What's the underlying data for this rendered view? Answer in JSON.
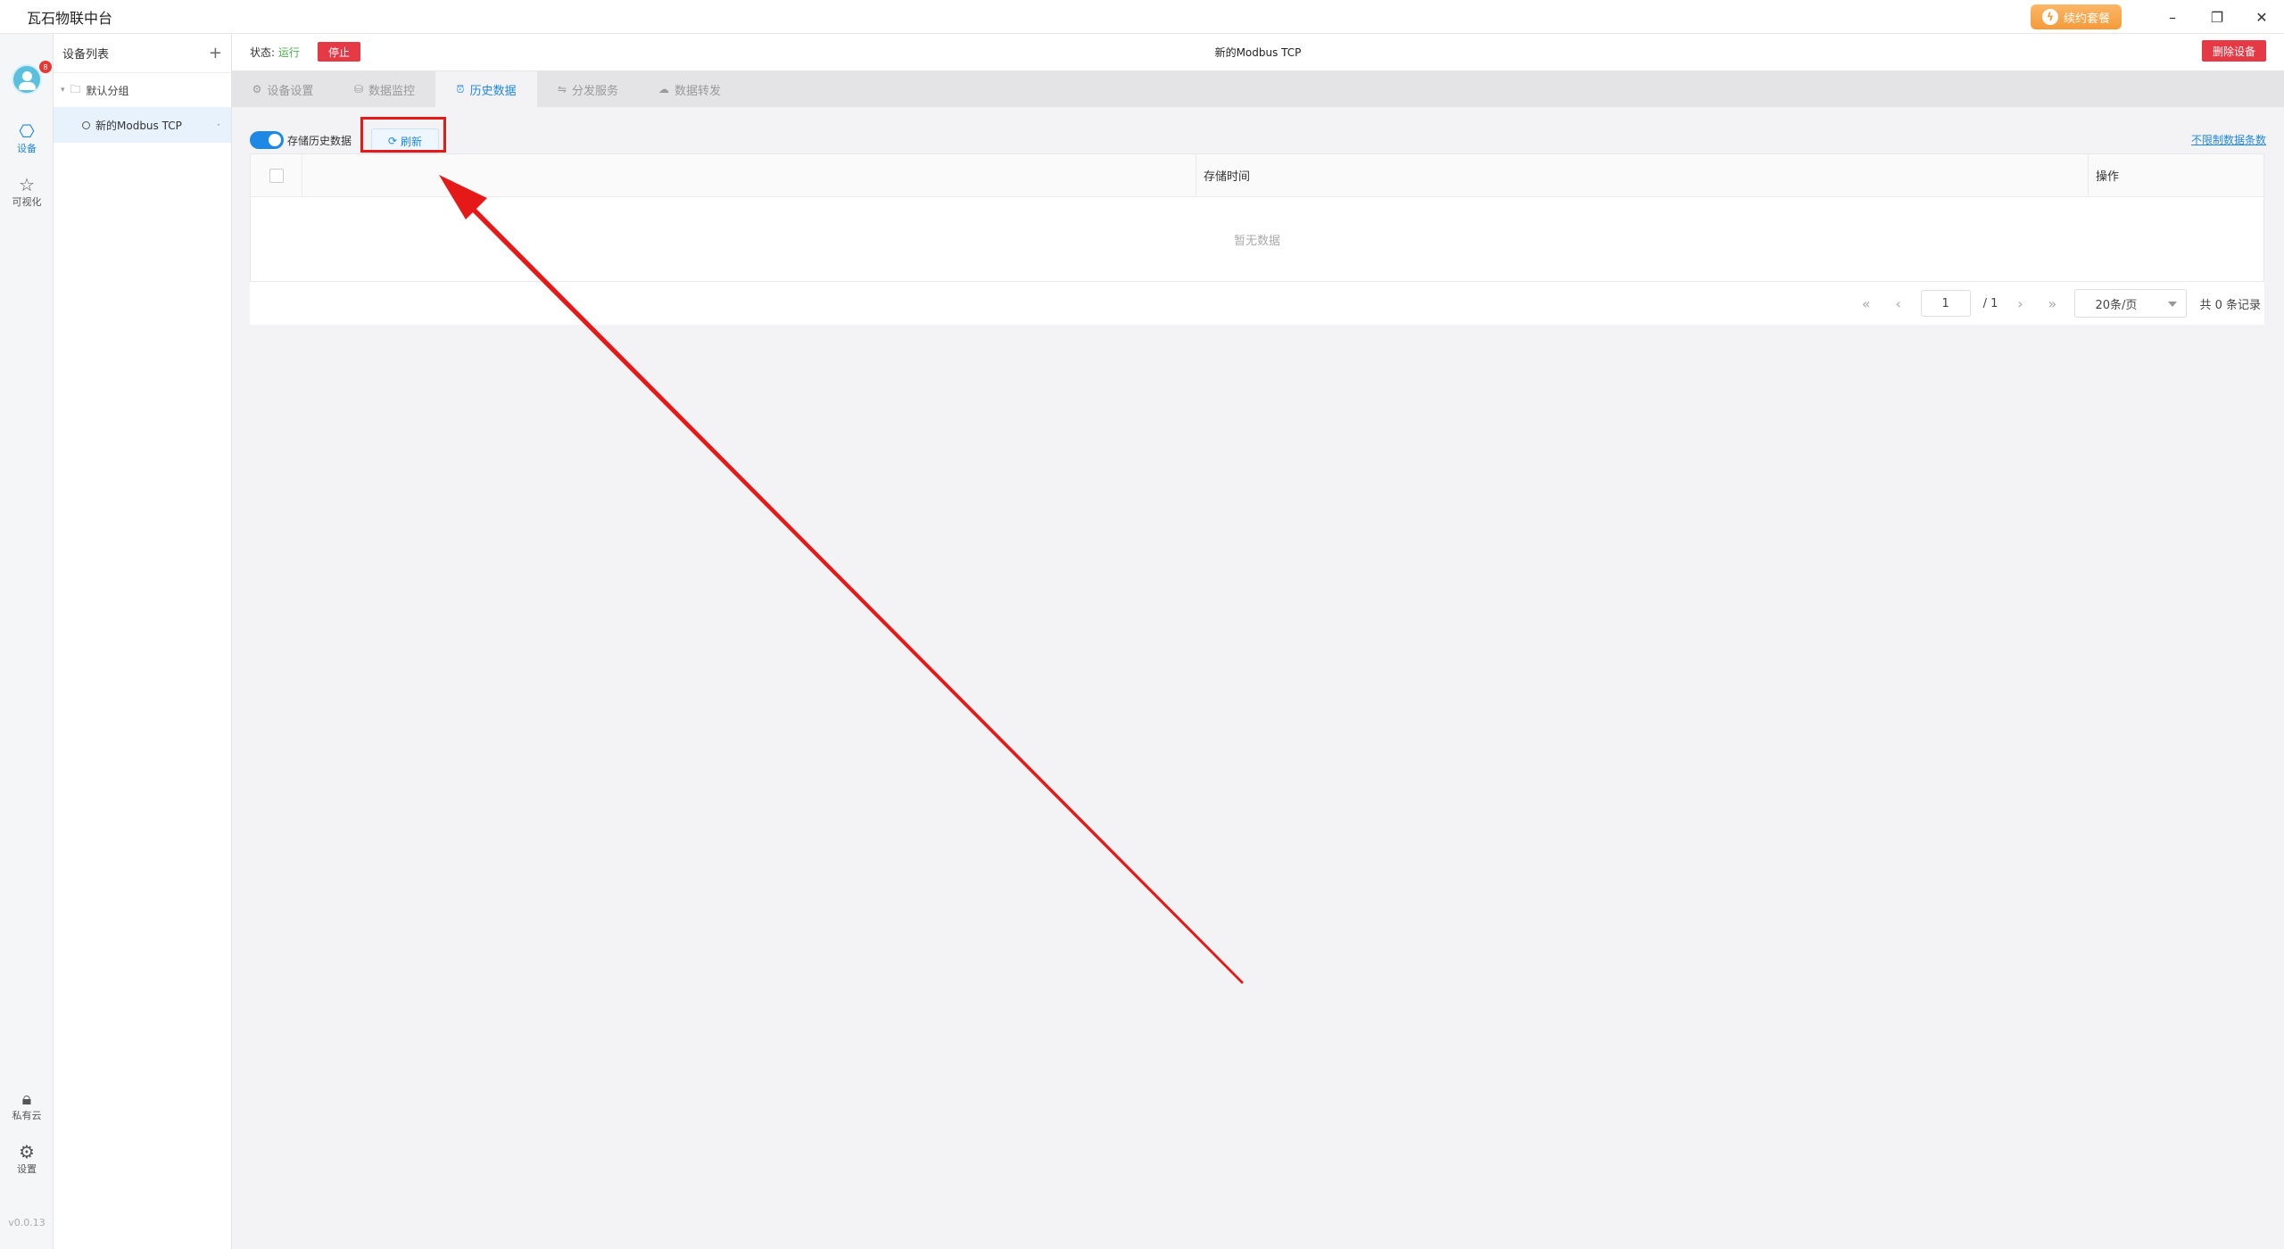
{
  "window": {
    "title": "瓦石物联中台",
    "renew_label": "续约套餐",
    "minimize": "–",
    "restore": "❐",
    "close": "✕"
  },
  "rail": {
    "avatar_badge": "8",
    "items": [
      {
        "label": "设备",
        "icon": "chip-icon"
      },
      {
        "label": "可视化",
        "icon": "star-icon"
      },
      {
        "label": "私有云",
        "icon": "lock-icon"
      },
      {
        "label": "设置",
        "icon": "gear-icon"
      }
    ],
    "version": "v0.0.13"
  },
  "device_panel": {
    "title": "设备列表",
    "add": "+",
    "group": "默认分组",
    "device": "新的Modbus TCP"
  },
  "header": {
    "status_label": "状态:",
    "status_value": "运行",
    "stop_label": "停止",
    "device_title": "新的Modbus TCP",
    "delete_label": "删除设备"
  },
  "tabs": [
    {
      "label": "设备设置",
      "icon": "settings-icon"
    },
    {
      "label": "数据监控",
      "icon": "database-icon"
    },
    {
      "label": "历史数据",
      "icon": "clock-icon"
    },
    {
      "label": "分发服务",
      "icon": "share-icon"
    },
    {
      "label": "数据转发",
      "icon": "cloud-icon"
    }
  ],
  "active_tab": "历史数据",
  "toolbar": {
    "store_history_label": "存储历史数据",
    "store_history_on": true,
    "refresh_label": "刷新",
    "unlimited_link": "不限制数据条数"
  },
  "table": {
    "columns": [
      "",
      "存储时间",
      "操作"
    ],
    "empty_text": "暂无数据",
    "rows": []
  },
  "pagination": {
    "current_page": "1",
    "total_pages": "/ 1",
    "page_size": "20条/页",
    "total_records": "共 0 条记录"
  },
  "colors": {
    "accent": "#1e88e5",
    "danger": "#e53945",
    "running": "#4caf50",
    "annotation": "#e61919"
  }
}
